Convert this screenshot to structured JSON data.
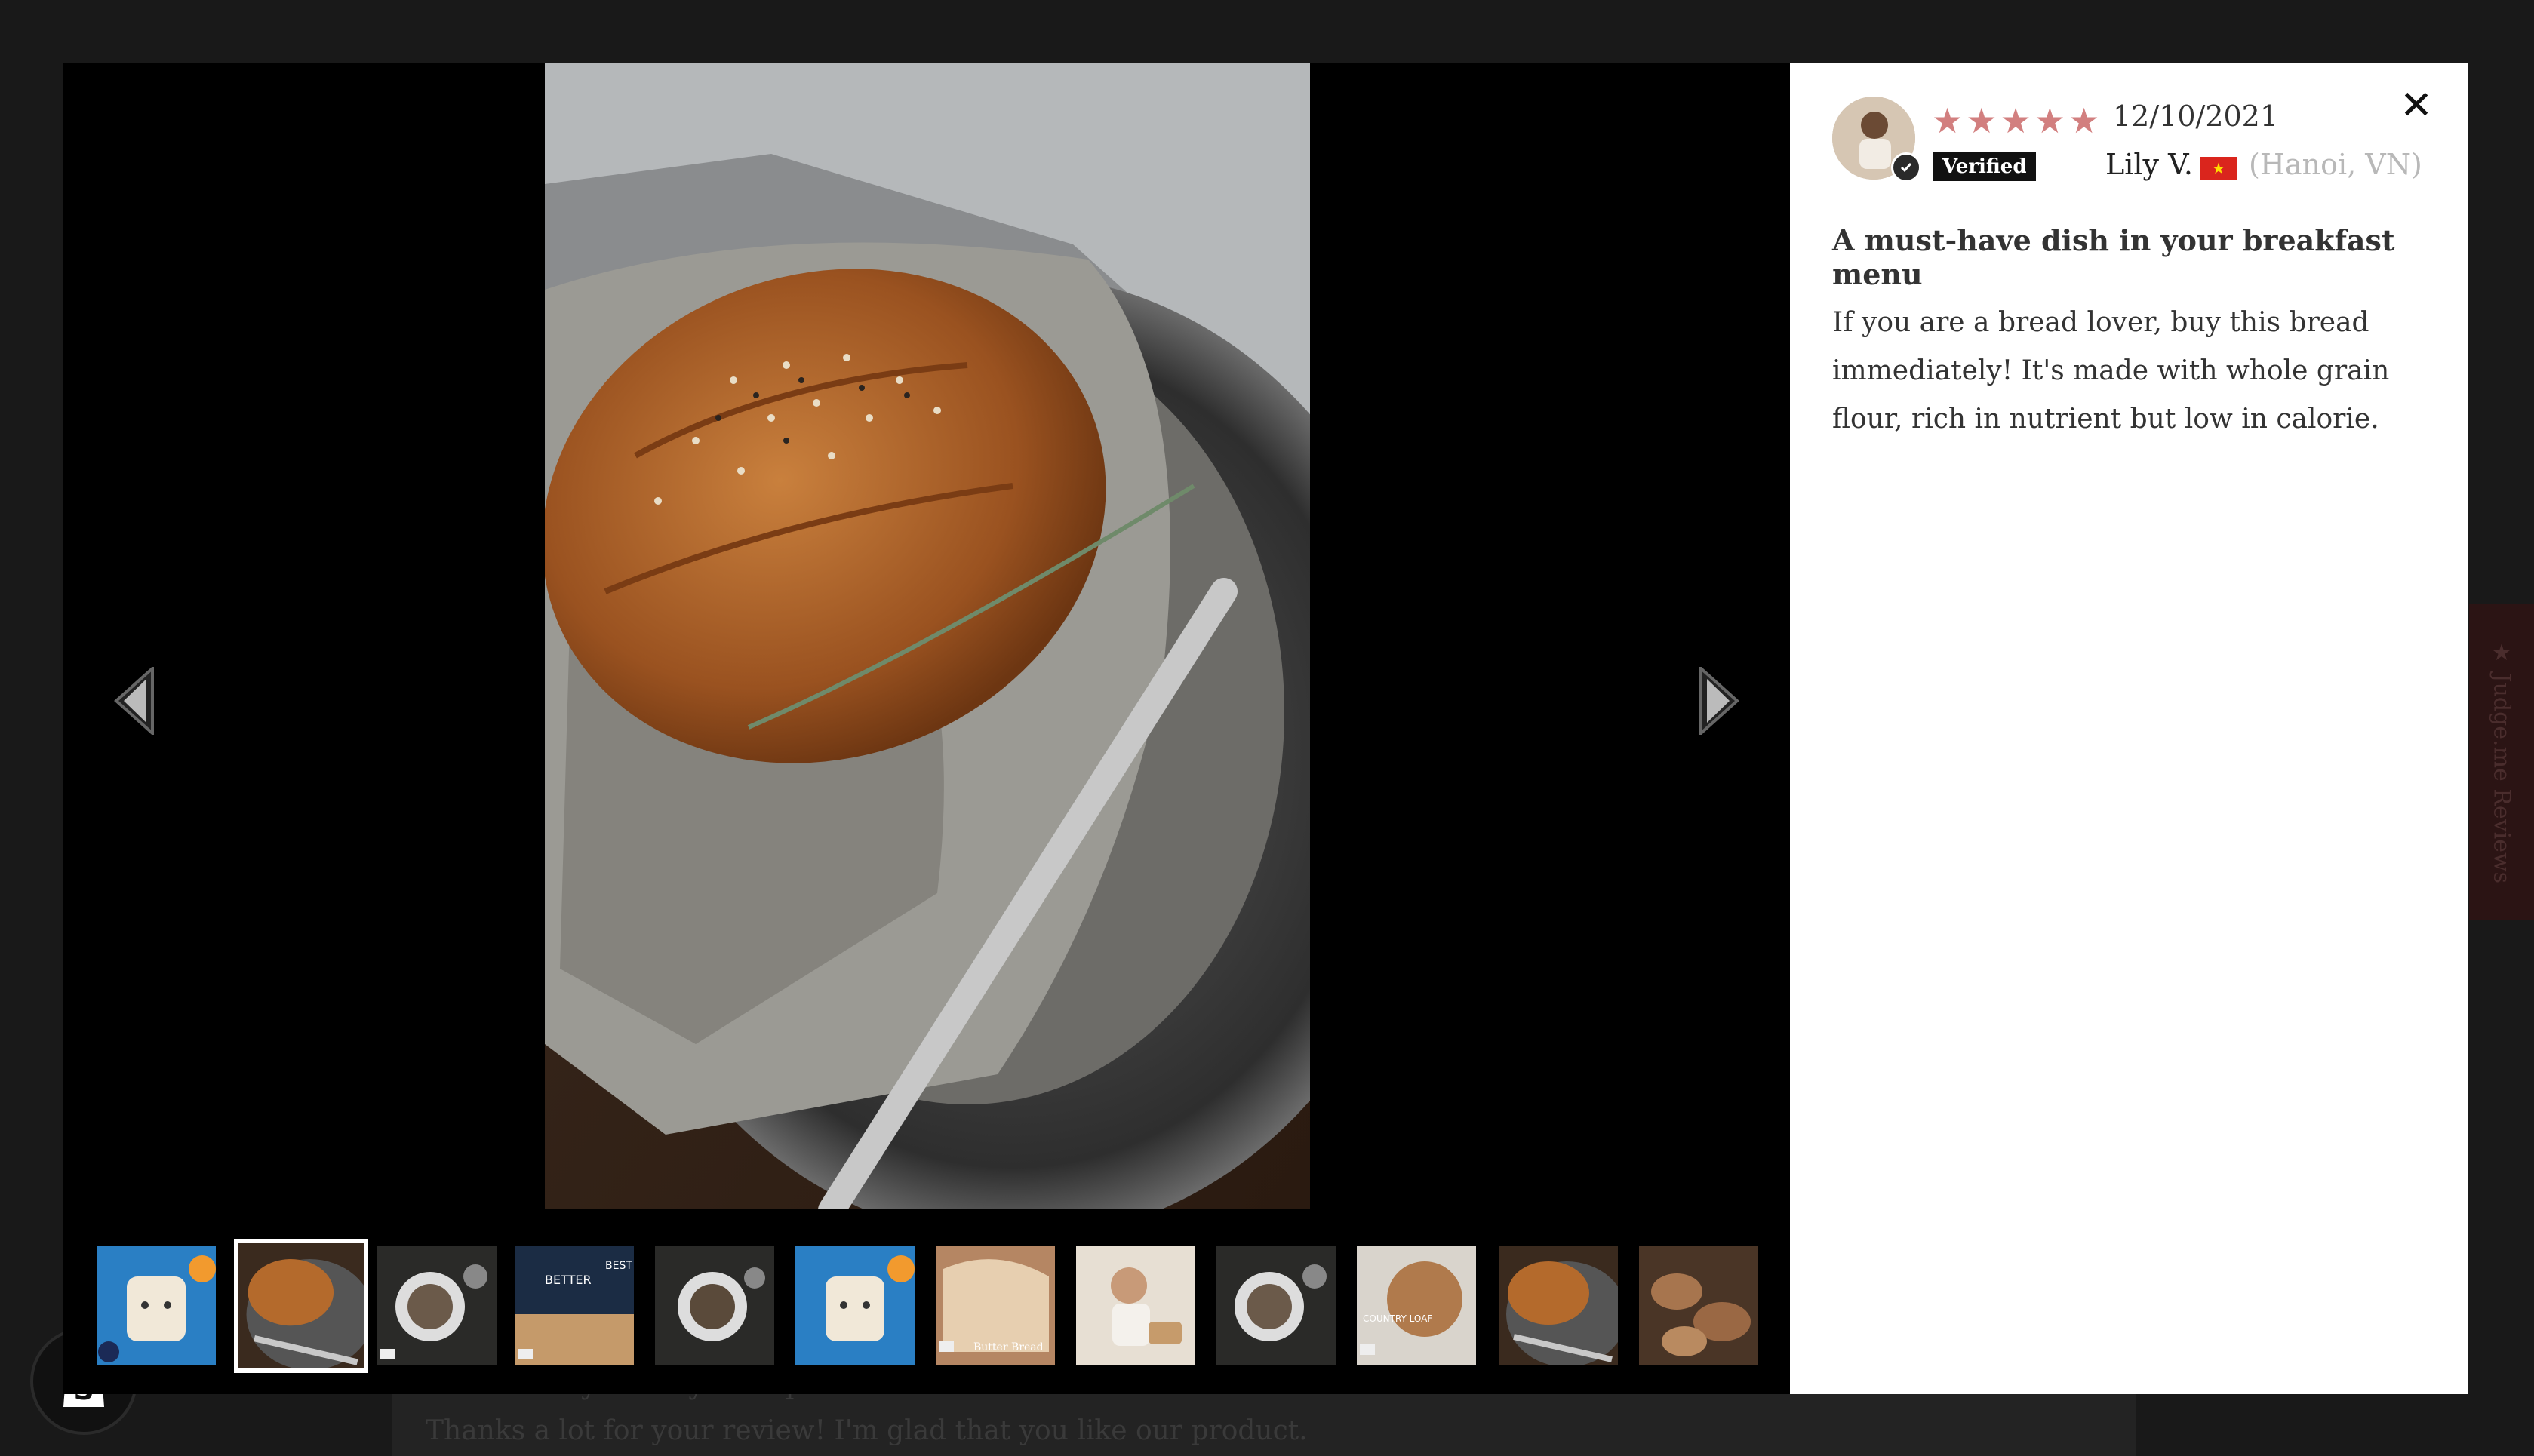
{
  "background": {
    "reply_header": ">> Healthy Lifestyles replied:",
    "reply_text": "Thanks a lot for your review! I'm glad that you like our product.",
    "side_tab_label": "★ Judge.me Reviews"
  },
  "gallery": {
    "prev_icon": "triangle-left-icon",
    "next_icon": "triangle-right-icon",
    "main_image": "bread-loaf-photo",
    "active_thumb_index": 1,
    "thumbnails": [
      {
        "subject": "toast-face-blue",
        "video": false,
        "caption": ""
      },
      {
        "subject": "braided-bread",
        "video": false,
        "caption": ""
      },
      {
        "subject": "oatmeal-bowl",
        "video": true,
        "caption": ""
      },
      {
        "subject": "bread-banner",
        "video": true,
        "caption": "BETTER BEST"
      },
      {
        "subject": "oatmeal-bowl",
        "video": false,
        "caption": ""
      },
      {
        "subject": "toast-face-blue",
        "video": false,
        "caption": ""
      },
      {
        "subject": "butter-bread",
        "video": true,
        "caption": "Butter Bread"
      },
      {
        "subject": "baby-with-bread",
        "video": false,
        "caption": ""
      },
      {
        "subject": "oatmeal-bowl",
        "video": false,
        "caption": ""
      },
      {
        "subject": "sourdough-recipe",
        "video": true,
        "caption": "COUNTRY LOAF RECIPE"
      },
      {
        "subject": "braided-bread",
        "video": false,
        "caption": ""
      },
      {
        "subject": "bread-rolls",
        "video": false,
        "caption": ""
      }
    ]
  },
  "review": {
    "close_label": "✕",
    "rating": 5,
    "star_color": "#d27f7f",
    "date": "12/10/2021",
    "verified_label": "Verified",
    "reviewer_name": "Lily V.",
    "location": "(Hanoi, VN)",
    "title": "A must-have dish in your breakfast menu",
    "body": "If you are a bread lover, buy this bread immediately! It's made with whole grain flour, rich in nutrient but low in calorie."
  }
}
